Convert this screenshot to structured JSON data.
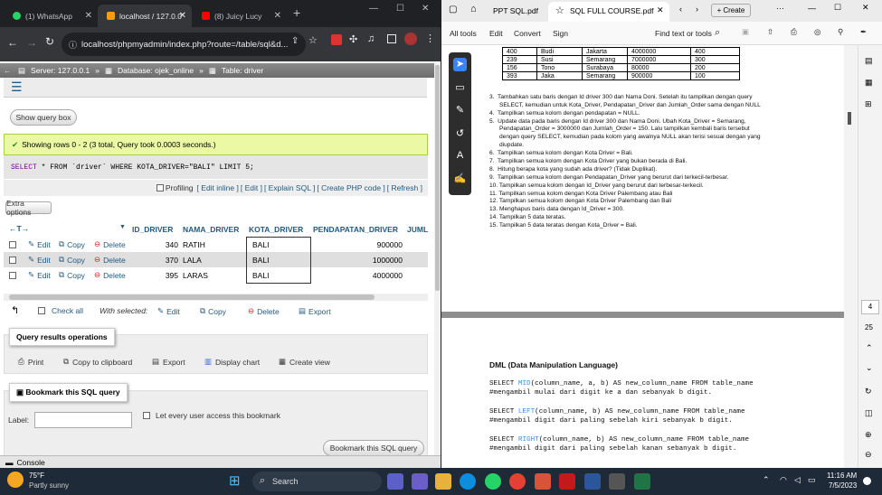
{
  "browser": {
    "tabs": [
      {
        "label": "(1) WhatsApp",
        "icon": "whatsapp-icon"
      },
      {
        "label": "localhost / 127.0.0",
        "icon": "phpmyadmin-icon"
      },
      {
        "label": "(8) Juicy Lucy",
        "icon": "youtube-icon"
      }
    ],
    "new_tab": "+",
    "url": "localhost/phpmyadmin/index.php?route=/table/sql&d..."
  },
  "pma": {
    "breadcrumb": {
      "server": "Server: 127.0.0.1",
      "database": "Database: ojek_online",
      "table": "Table: driver"
    },
    "show_query_box": "Show query box",
    "success": "Showing rows 0 - 2 (3 total, Query took 0.0003 seconds.)",
    "sql": {
      "select": "SELECT",
      "rest": " * FROM `driver` WHERE KOTA_DRIVER=\"BALI\" LIMIT 5;"
    },
    "profiling": "Profiling",
    "links": [
      "[ Edit inline ]",
      "[ Edit ]",
      "[ Explain SQL ]",
      "[ Create PHP code ]",
      "[ Refresh ]"
    ],
    "extra_options": "Extra options",
    "columns": [
      "ID_DRIVER",
      "NAMA_DRIVER",
      "KOTA_DRIVER",
      "PENDAPATAN_DRIVER",
      "JUML"
    ],
    "row_actions": {
      "edit": "Edit",
      "copy": "Copy",
      "delete": "Delete"
    },
    "rows": [
      {
        "id": "340",
        "nama": "RATIH",
        "kota": "BALI",
        "pendapatan": "900000"
      },
      {
        "id": "370",
        "nama": "LALA",
        "kota": "BALI",
        "pendapatan": "1000000"
      },
      {
        "id": "395",
        "nama": "LARAS",
        "kota": "BALI",
        "pendapatan": "4000000"
      }
    ],
    "bulk": {
      "check_all": "Check all",
      "with_selected": "With selected:",
      "edit": "Edit",
      "copy": "Copy",
      "delete": "Delete",
      "export": "Export"
    },
    "qro": {
      "legend": "Query results operations",
      "print": "Print",
      "copy": "Copy to clipboard",
      "export": "Export",
      "chart": "Display chart",
      "view": "Create view"
    },
    "bookmark": {
      "legend": "Bookmark this SQL query",
      "label": "Label:",
      "every_user": "Let every user access this bookmark",
      "button": "Bookmark this SQL query"
    },
    "console": "Console"
  },
  "edge": {
    "tabs": [
      {
        "label": "PPT SQL.pdf"
      },
      {
        "label": "SQL FULL COURSE.pdf"
      }
    ],
    "create": "Create",
    "toolbar": {
      "all_tools": "All tools",
      "edit": "Edit",
      "convert": "Convert",
      "sign": "Sign",
      "find": "Find text or tools"
    },
    "page_num": "4",
    "page_total": "25"
  },
  "pdf": {
    "table": [
      [
        "400",
        "Budi",
        "Jakarta",
        "4000000",
        "400"
      ],
      [
        "239",
        "Susi",
        "Semarang",
        "7000000",
        "300"
      ],
      [
        "156",
        "Tono",
        "Surabaya",
        "80000",
        "200"
      ],
      [
        "393",
        "Jaka",
        "Semarang",
        "900000",
        "100"
      ]
    ],
    "items": [
      "3.  Tambahkan satu baris dengan Id driver 300 dan Nama Doni. Setelah itu tampilkan dengan query",
      "      SELECT, kemudian untuk Kota_Driver, Pendapatan_Driver dan Jumlah_Order sama dengan NULL",
      "4.  Tampilkan semua kolom dengan pendapatan = NULL.",
      "5.  Update data pada baris dengan Id driver 300 dan Nama Doni. Ubah Kota_Driver = Semarang,",
      "      Pendapatan_Order = 3000000 dan Jumlah_Order = 150. Lalu tampilkan kembali baris tersebut",
      "      dengan query SELECT, kemudian pada kolom yang awalnya NULL akan terisi sesuai dengan yang",
      "      diupdate.",
      "6.  Tampilkan semua kolom dengan Kota Driver = Bali.",
      "7.  Tampilkan semua kolom dengan Kota Driver yang bukan berada di Bali.",
      "8.  Hitung berapa kota yang sudah ada driver? (Tidak Duplikat).",
      "9.  Tampilkan semua kolom dengan Pendapatan_Driver yang berurut dari terkecil-terbesar.",
      "10. Tampilkan semua kolom dengan Id_Driver yang berurut dari terbesar-terkecil.",
      "11. Tampilkan semua kolom dengan Kota Driver Palembang atau Bali",
      "12. Tampilkan semua kolom dengan Kota Driver Palembang dan Bali",
      "13. Menghapus baris data dengan Id_Driver = 300.",
      "14. Tampilkan 5 data teratas.",
      "15. Tampilkan 5 data teratas dengan Kota_Driver = Bali."
    ],
    "dml_title": "DML (Data Manipulation Language)",
    "code": [
      {
        "pre": "SELECT ",
        "kw": "MID",
        "post": "(column_name, a, b) AS new_column_name FROM table_name"
      },
      {
        "pre": "#mengambil mulai dari digit ke a dan sebanyak b digit.",
        "kw": "",
        "post": ""
      },
      {
        "pre": "SELECT ",
        "kw": "LEFT",
        "post": "(column_name, b) AS new_column_name FROM table_name"
      },
      {
        "pre": "#mengambil digit dari paling sebelah kiri sebanyak b digit.",
        "kw": "",
        "post": ""
      },
      {
        "pre": "SELECT ",
        "kw": "RIGHT",
        "post": "(column_name, b) AS new_column_name FROM table_name"
      },
      {
        "pre": "#mengambil digit dari paling sebelah kanan sebanyak b digit.",
        "kw": "",
        "post": ""
      }
    ]
  },
  "taskbar": {
    "weather_temp": "75°F",
    "weather_desc": "Partly sunny",
    "search": "Search",
    "time": "11:16 AM",
    "date": "7/5/2023"
  }
}
